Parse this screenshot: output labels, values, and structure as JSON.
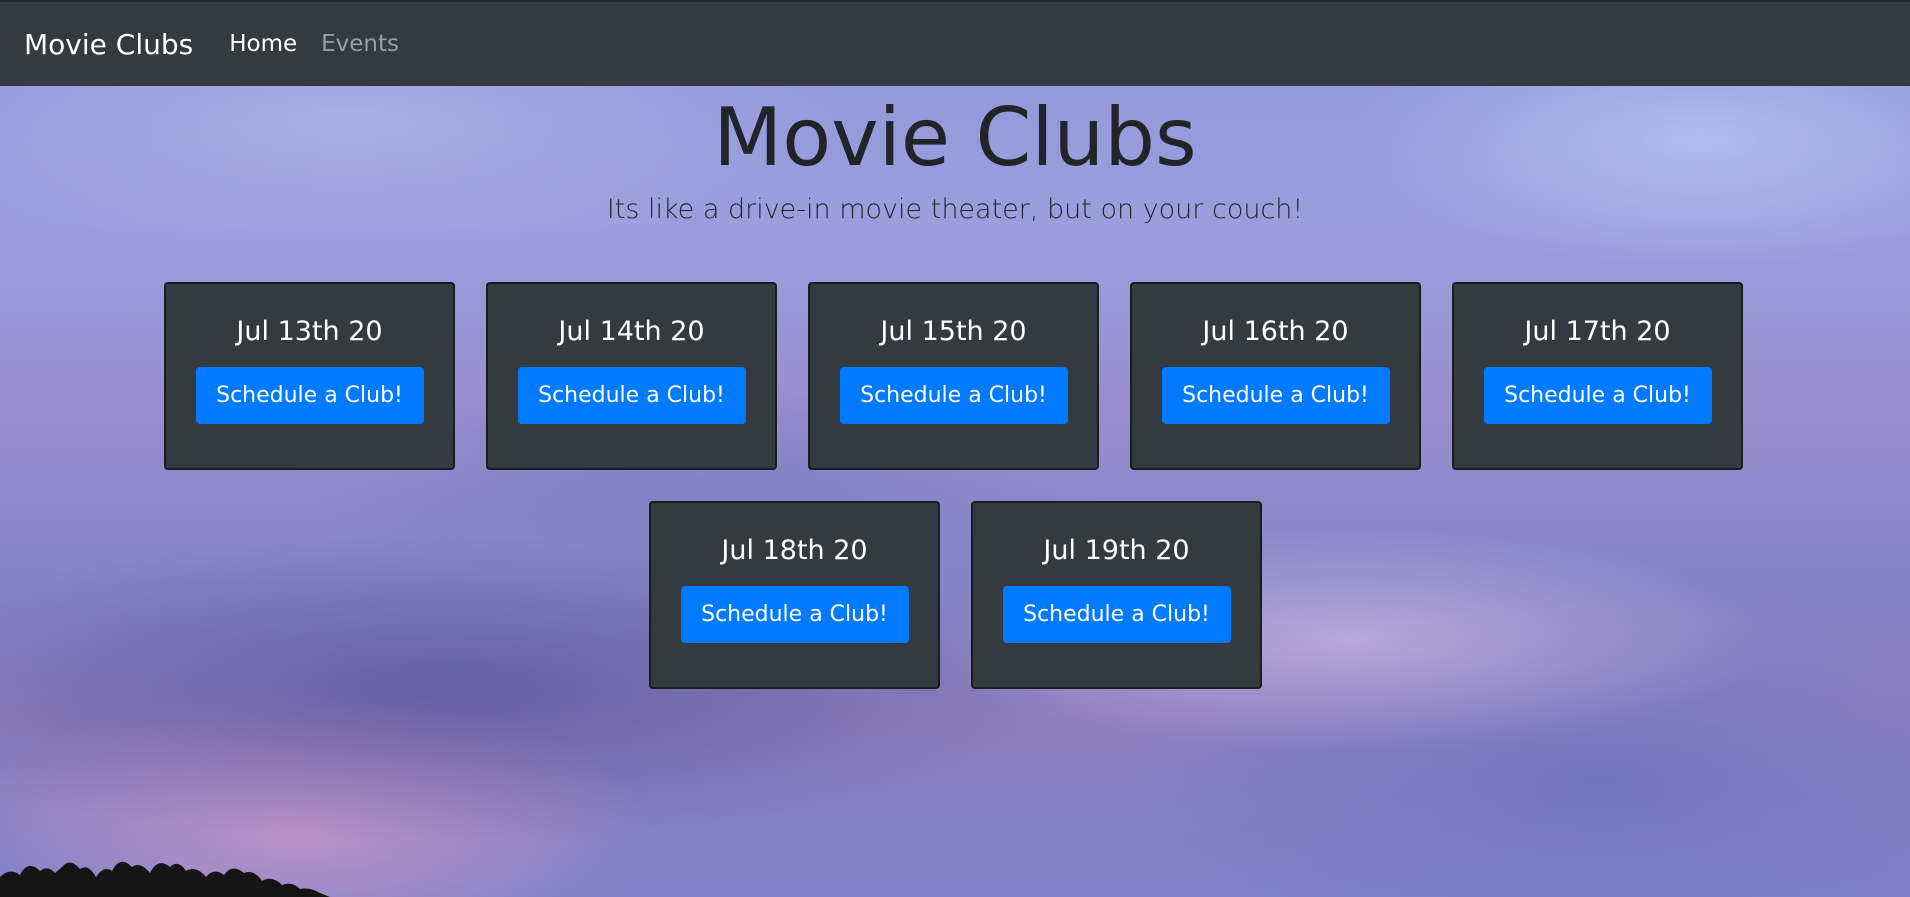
{
  "navbar": {
    "brand": "Movie Clubs",
    "links": [
      {
        "label": "Home",
        "active": true
      },
      {
        "label": "Events",
        "active": false
      }
    ]
  },
  "hero": {
    "title": "Movie Clubs",
    "subtitle": "Its like a drive-in movie theater, but on your couch!"
  },
  "events": [
    {
      "date": "Jul 13th 20",
      "button_label": "Schedule a Club!"
    },
    {
      "date": "Jul 14th 20",
      "button_label": "Schedule a Club!"
    },
    {
      "date": "Jul 15th 20",
      "button_label": "Schedule a Club!"
    },
    {
      "date": "Jul 16th 20",
      "button_label": "Schedule a Club!"
    },
    {
      "date": "Jul 17th 20",
      "button_label": "Schedule a Club!"
    },
    {
      "date": "Jul 18th 20",
      "button_label": "Schedule a Club!"
    },
    {
      "date": "Jul 19th 20",
      "button_label": "Schedule a Club!"
    }
  ],
  "colors": {
    "navbar": "#343a40",
    "card": "#343a40",
    "button": "#007bff",
    "text_dark": "#212529"
  }
}
